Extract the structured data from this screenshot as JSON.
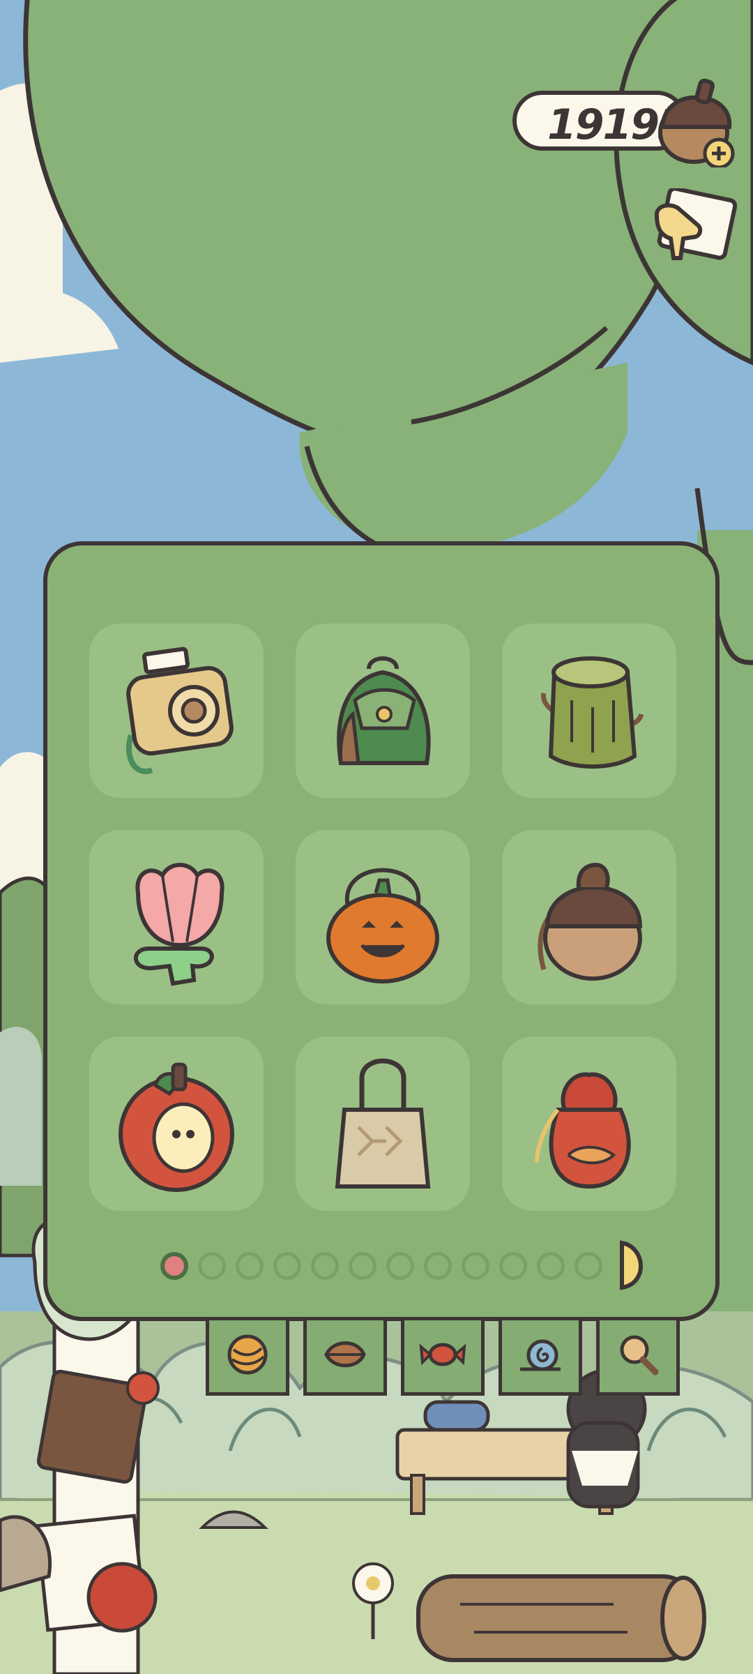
{
  "currency": {
    "amount": "191931",
    "icon": "acorn-icon",
    "add_icon": "plus-icon"
  },
  "mail": {
    "icon": "mail-icon"
  },
  "bags": [
    {
      "name": "camera-bag"
    },
    {
      "name": "green-backpack"
    },
    {
      "name": "stump-bag"
    },
    {
      "name": "tulip-bag"
    },
    {
      "name": "pumpkin-bag"
    },
    {
      "name": "acorn-bag"
    },
    {
      "name": "apple-bag"
    },
    {
      "name": "tote-bag"
    },
    {
      "name": "pouch-bag"
    }
  ],
  "pagination": {
    "total_pages": 12,
    "current_page": 1
  },
  "tabs": [
    {
      "icon": "yarn-icon"
    },
    {
      "icon": "leaf-icon"
    },
    {
      "icon": "candy-icon"
    },
    {
      "icon": "snail-icon"
    },
    {
      "icon": "magnifier-icon"
    }
  ],
  "colors": {
    "panel": "#8ab275",
    "slot": "#9bc086",
    "outline": "#3d3535",
    "active_dot": "#e08080"
  }
}
